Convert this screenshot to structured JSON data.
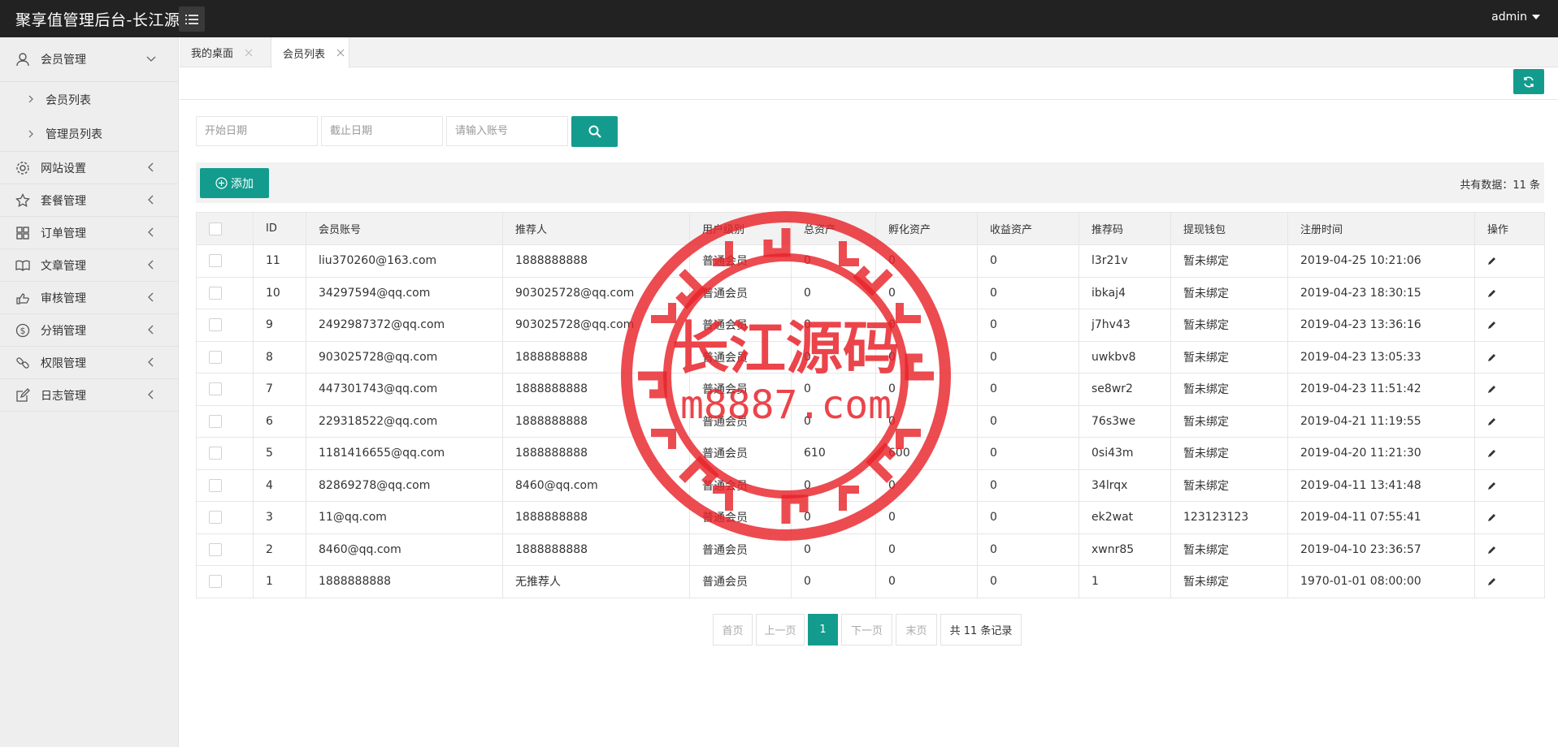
{
  "app": {
    "title": "聚享值管理后台-长江源",
    "user": "admin"
  },
  "sidebar": {
    "items": [
      {
        "label": "会员管理",
        "icon": "user-icon",
        "open": true,
        "children": [
          {
            "label": "会员列表"
          },
          {
            "label": "管理员列表"
          }
        ]
      },
      {
        "label": "网站设置",
        "icon": "gear-icon"
      },
      {
        "label": "套餐管理",
        "icon": "star-icon"
      },
      {
        "label": "订单管理",
        "icon": "grid-icon"
      },
      {
        "label": "文章管理",
        "icon": "book-icon"
      },
      {
        "label": "审核管理",
        "icon": "hand-icon"
      },
      {
        "label": "分销管理",
        "icon": "dollar-icon"
      },
      {
        "label": "权限管理",
        "icon": "link-icon"
      },
      {
        "label": "日志管理",
        "icon": "edit-icon"
      }
    ]
  },
  "tabs": [
    {
      "label": "我的桌面"
    },
    {
      "label": "会员列表",
      "active": true
    }
  ],
  "search": {
    "start_placeholder": "开始日期",
    "end_placeholder": "截止日期",
    "account_placeholder": "请输入账号"
  },
  "toolbar": {
    "add_label": "添加",
    "total_text": "共有数据：11 条"
  },
  "table": {
    "columns": [
      "ID",
      "会员账号",
      "推荐人",
      "用户级别",
      "总资产",
      "孵化资产",
      "收益资产",
      "推荐码",
      "提现钱包",
      "注册时间",
      "操作"
    ],
    "rows": [
      [
        "11",
        "liu370260@163.com",
        "1888888888",
        "普通会员",
        "0",
        "0",
        "0",
        "l3r21v",
        "暂未绑定",
        "2019-04-25 10:21:06"
      ],
      [
        "10",
        "34297594@qq.com",
        "903025728@qq.com",
        "普通会员",
        "0",
        "0",
        "0",
        "ibkaj4",
        "暂未绑定",
        "2019-04-23 18:30:15"
      ],
      [
        "9",
        "2492987372@qq.com",
        "903025728@qq.com",
        "普通会员",
        "0",
        "0",
        "0",
        "j7hv43",
        "暂未绑定",
        "2019-04-23 13:36:16"
      ],
      [
        "8",
        "903025728@qq.com",
        "1888888888",
        "普通会员",
        "0",
        "0",
        "0",
        "uwkbv8",
        "暂未绑定",
        "2019-04-23 13:05:33"
      ],
      [
        "7",
        "447301743@qq.com",
        "1888888888",
        "普通会员",
        "0",
        "0",
        "0",
        "se8wr2",
        "暂未绑定",
        "2019-04-23 11:51:42"
      ],
      [
        "6",
        "229318522@qq.com",
        "1888888888",
        "普通会员",
        "0",
        "0",
        "0",
        "76s3we",
        "暂未绑定",
        "2019-04-21 11:19:55"
      ],
      [
        "5",
        "1181416655@qq.com",
        "1888888888",
        "普通会员",
        "610",
        "600",
        "0",
        "0si43m",
        "暂未绑定",
        "2019-04-20 11:21:30"
      ],
      [
        "4",
        "82869278@qq.com",
        "8460@qq.com",
        "普通会员",
        "0",
        "0",
        "0",
        "34lrqx",
        "暂未绑定",
        "2019-04-11 13:41:48"
      ],
      [
        "3",
        "11@qq.com",
        "1888888888",
        "普通会员",
        "0",
        "0",
        "0",
        "ek2wat",
        "123123123",
        "2019-04-11 07:55:41"
      ],
      [
        "2",
        "8460@qq.com",
        "1888888888",
        "普通会员",
        "0",
        "0",
        "0",
        "xwnr85",
        "暂未绑定",
        "2019-04-10 23:36:57"
      ],
      [
        "1",
        "1888888888",
        "无推荐人",
        "普通会员",
        "0",
        "0",
        "0",
        "1",
        "暂未绑定",
        "1970-01-01 08:00:00"
      ]
    ]
  },
  "pagination": {
    "first": "首页",
    "prev": "上一页",
    "current": "1",
    "next": "下一页",
    "last": "末页",
    "total": "共 11 条记录"
  },
  "watermark": {
    "line1": "长江源码",
    "line2": "m8887.com"
  },
  "colors": {
    "accent": "#139c8e",
    "topbar": "#222222",
    "watermark": "#e8232a"
  }
}
